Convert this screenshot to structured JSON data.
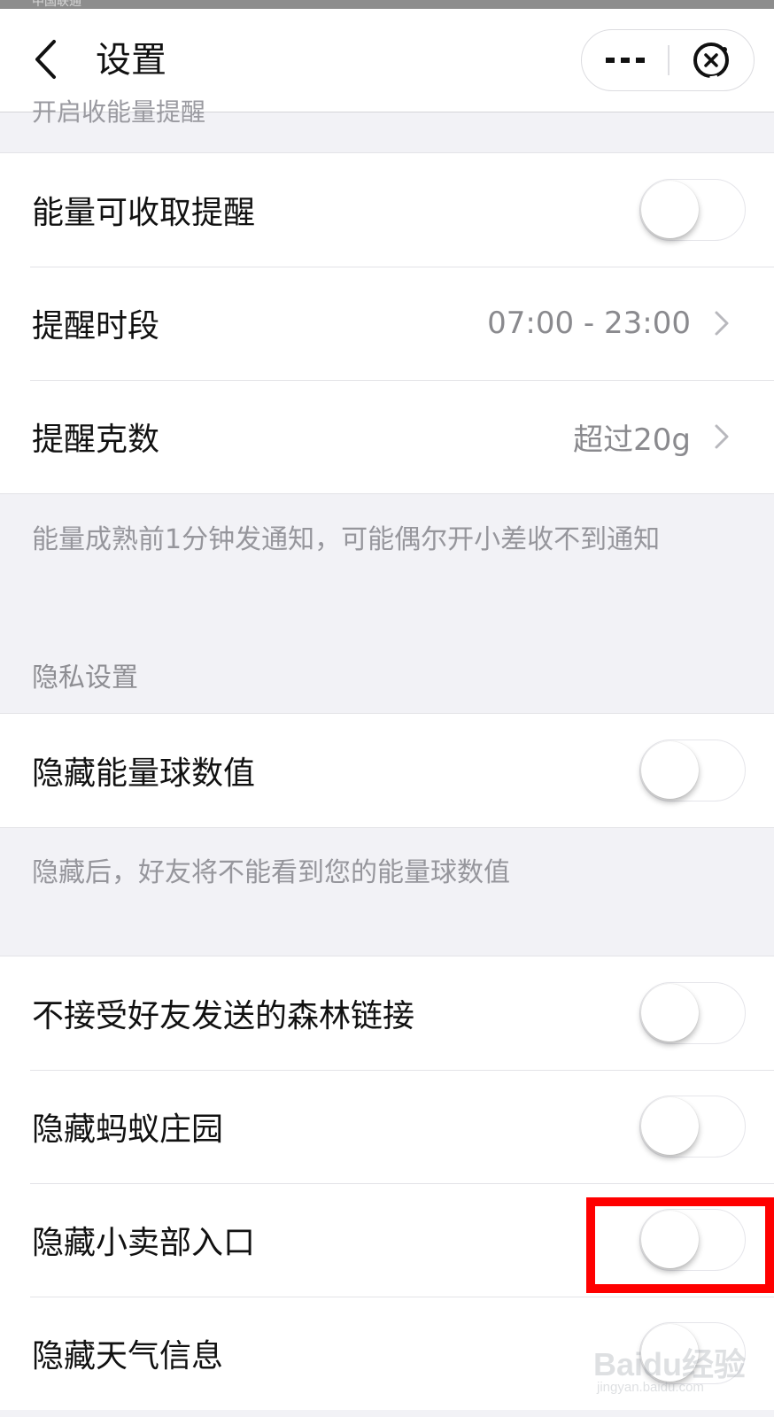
{
  "status_bar": {
    "carrier": "中国联通"
  },
  "nav": {
    "title": "设置",
    "more_icon": "ellipsis-icon",
    "close_icon": "miniprogram-close-icon"
  },
  "partial_section_header": "开启收能量提醒",
  "energy_group": {
    "items": [
      {
        "label": "能量可收取提醒",
        "type": "switch",
        "checked": false
      },
      {
        "label": "提醒时段",
        "type": "link",
        "value": "07:00 - 23:00",
        "icon": "chevron-right-icon"
      },
      {
        "label": "提醒克数",
        "type": "link",
        "value": "超过20g",
        "icon": "chevron-right-icon"
      }
    ],
    "note": "能量成熟前1分钟发通知，可能偶尔开小差收不到通知"
  },
  "privacy": {
    "header": "隐私设置",
    "items": [
      {
        "label": "隐藏能量球数值",
        "type": "switch",
        "checked": false
      }
    ],
    "note": "隐藏后，好友将不能看到您的能量球数值"
  },
  "other_group": {
    "items": [
      {
        "label": "不接受好友发送的森林链接",
        "type": "switch",
        "checked": false
      },
      {
        "label": "隐藏蚂蚁庄园",
        "type": "switch",
        "checked": false
      },
      {
        "label": "隐藏小卖部入口",
        "type": "switch",
        "checked": false,
        "highlighted": true
      },
      {
        "label": "隐藏天气信息",
        "type": "switch",
        "checked": false
      }
    ]
  },
  "annotation": {
    "highlight_color": "#ff0000"
  },
  "watermark": {
    "logo": "Baidu经验",
    "url": "jingyan.baidu.com"
  },
  "colors": {
    "background": "#f2f2f6",
    "cell_background": "#ffffff",
    "secondary_text": "#8a8a8e"
  }
}
